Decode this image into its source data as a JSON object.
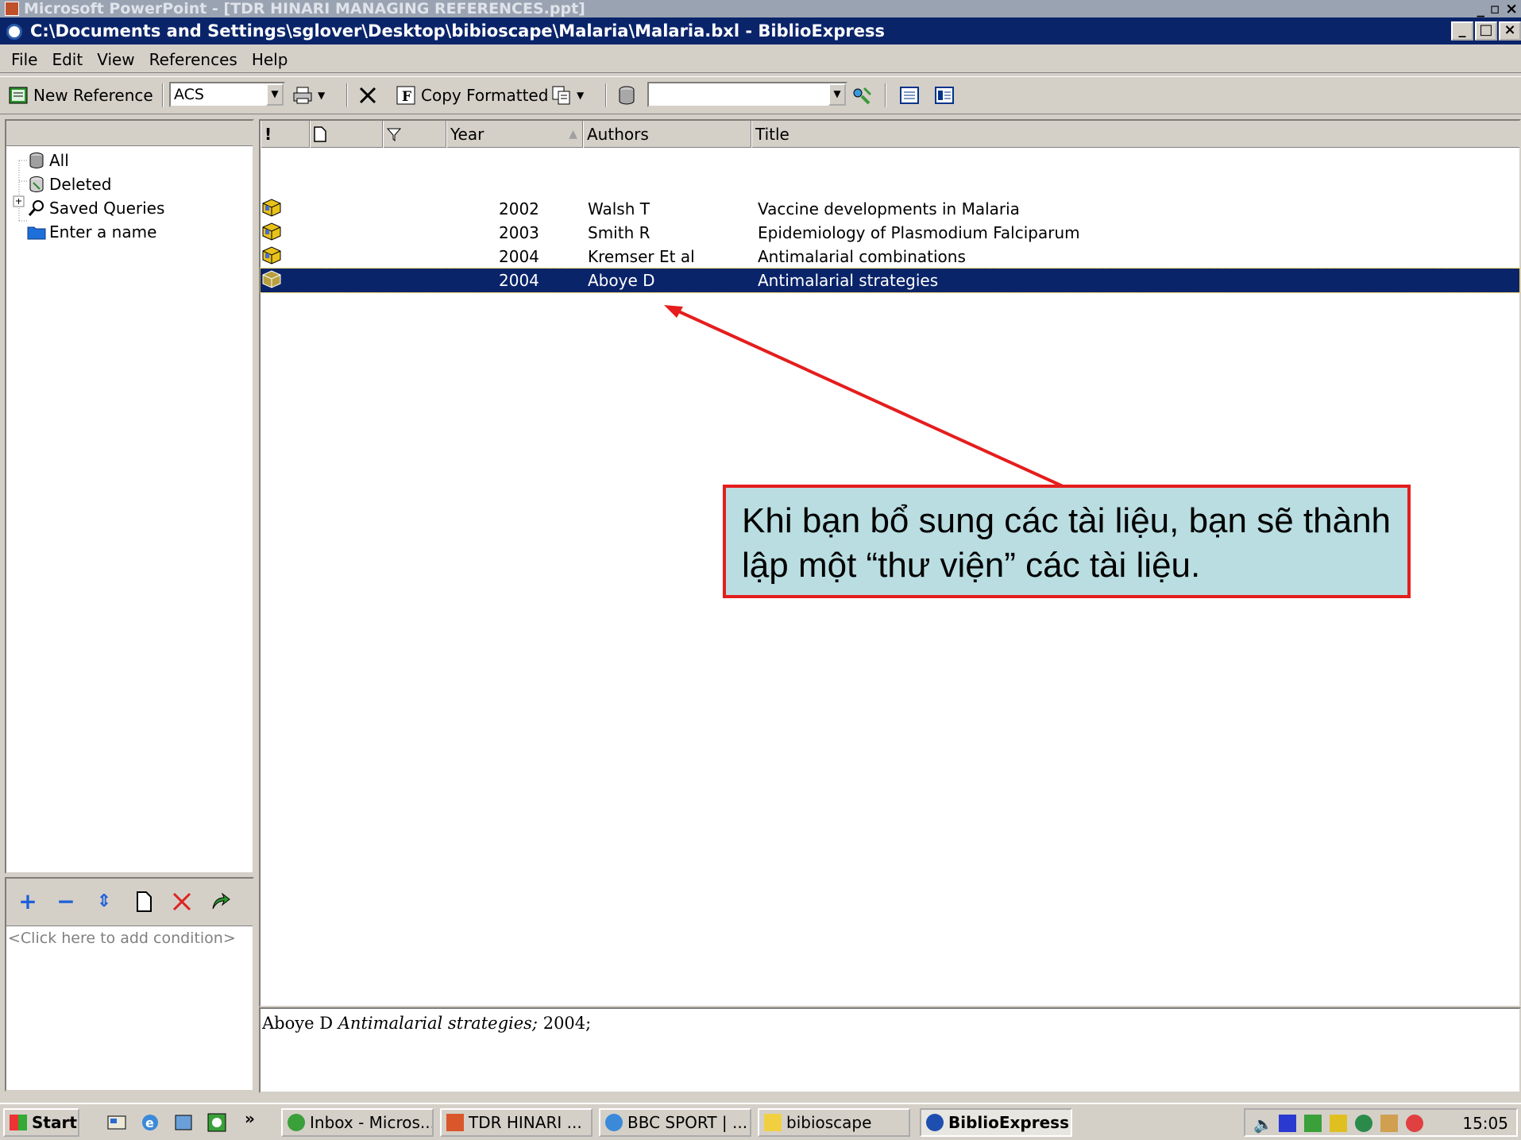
{
  "ppt_window": {
    "title": "Microsoft PowerPoint - [TDR HINARI MANAGING REFERENCES.ppt]",
    "controls": "_ ▫ ×"
  },
  "window": {
    "title": "C:\\Documents and Settings\\sglover\\Desktop\\bibioscape\\Malaria\\Malaria.bxl - BiblioExpress",
    "minimize": "_",
    "maximize": "□",
    "close": "×"
  },
  "menu": [
    "File",
    "Edit",
    "View",
    "References",
    "Help"
  ],
  "toolbar": {
    "new_reference": "New Reference",
    "style_value": "ACS",
    "copy_formatted": "Copy Formatted",
    "search_value": ""
  },
  "tree": [
    {
      "label": "All",
      "icon": "database-icon"
    },
    {
      "label": "Deleted",
      "icon": "trash-icon"
    },
    {
      "label": "Saved Queries",
      "icon": "magnifier-icon"
    },
    {
      "label": "Enter a name",
      "icon": "folder-icon"
    }
  ],
  "query": {
    "placeholder": "<Click here to add condition>"
  },
  "columns": {
    "flag": "!",
    "type": "",
    "mark": "",
    "year": "Year",
    "authors": "Authors",
    "title": "Title"
  },
  "references": [
    {
      "year": "2002",
      "authors": "Walsh T",
      "title": "Vaccine developments in Malaria",
      "selected": false
    },
    {
      "year": "2003",
      "authors": "Smith R",
      "title": "Epidemiology of Plasmodium Falciparum",
      "selected": false
    },
    {
      "year": "2004",
      "authors": "Kremser Et al",
      "title": "Antimalarial combinations",
      "selected": false
    },
    {
      "year": "2004",
      "authors": "Aboye D",
      "title": "Antimalarial strategies",
      "selected": true
    }
  ],
  "preview": {
    "author": "Aboye D",
    "title": "Antimalarial strategies;",
    "year": "2004;"
  },
  "callout": {
    "text": "Khi bạn bổ sung các tài liệu, bạn sẽ thành lập một “thư viện” các tài liệu.",
    "border_color": "#e51d1d",
    "fill_color": "#b9dde1"
  },
  "taskbar": {
    "start": "Start",
    "chevron": "»",
    "tasks": [
      {
        "label": "Inbox - Micros...",
        "active": false
      },
      {
        "label": "TDR HINARI ...",
        "active": false
      },
      {
        "label": "BBC SPORT | ...",
        "active": false
      },
      {
        "label": "bibioscape",
        "active": false
      },
      {
        "label": "BiblioExpress",
        "active": true
      }
    ],
    "clock": "15:05"
  }
}
